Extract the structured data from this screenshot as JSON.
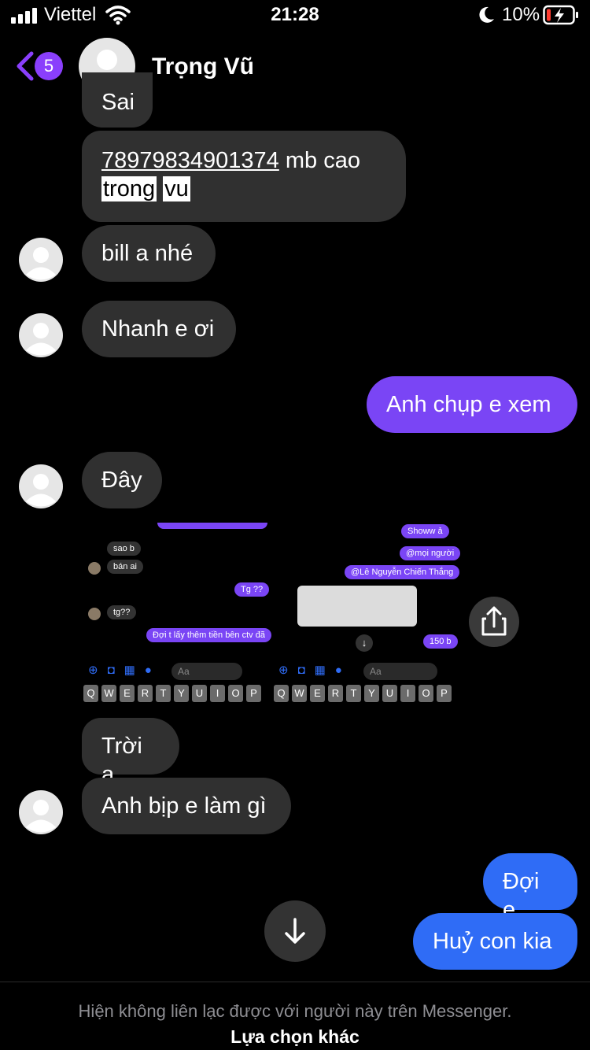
{
  "status_bar": {
    "carrier": "Viettel",
    "time": "21:28",
    "battery": "10%"
  },
  "header": {
    "back_count": "5",
    "contact_name": "Trọng Vũ",
    "accent_color": "#8a3ffc"
  },
  "messages": [
    {
      "side": "in",
      "text": "Sai"
    },
    {
      "side": "in",
      "account": "78979834901374",
      "bank": " mb cao",
      "name_a": "trong",
      "name_b": "vu"
    },
    {
      "side": "in",
      "text": "bill a nhé"
    },
    {
      "side": "in",
      "text": "Nhanh e ơi"
    },
    {
      "side": "out",
      "text": "Anh chụp e xem"
    },
    {
      "side": "in",
      "text": "Đây"
    },
    {
      "side": "in",
      "text": "Trời ạ"
    },
    {
      "side": "in",
      "text": "Anh bịp e làm gì"
    },
    {
      "side": "out",
      "text": "Đợi e"
    },
    {
      "side": "out",
      "text": "Huỷ con kia"
    }
  ],
  "shared_image": {
    "left": {
      "bubbles": [
        "sao b",
        "bán ai",
        "Tg ??",
        "tg??",
        "Đợi t lấy thêm tiền bên ctv đã"
      ],
      "input_placeholder": "Aa"
    },
    "right": {
      "bubbles": [
        "Showw ả",
        "@mọi người",
        "@Lê Nguyễn Chiến Thắng",
        "150 b"
      ],
      "input_placeholder": "Aa"
    },
    "keyboard_row": [
      "Q",
      "W",
      "E",
      "R",
      "T",
      "Y",
      "U",
      "I",
      "O",
      "P"
    ]
  },
  "footer": {
    "notice": "Hiện không liên lạc được với người này trên Messenger.",
    "alternative": "Lựa chọn khác"
  },
  "colors": {
    "incoming_bubble": "#303030",
    "outgoing_purple": "#7a45f5",
    "outgoing_blue": "#2f6cf6"
  }
}
